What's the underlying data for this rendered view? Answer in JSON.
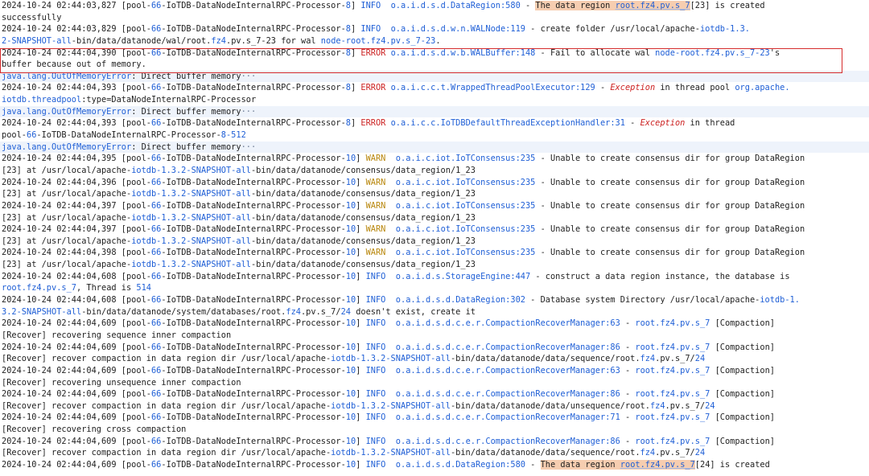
{
  "lines": [
    {
      "k": "L1a",
      "parts": [
        [
          "t",
          "2024-10-24 02:44:03,827 [pool-"
        ],
        [
          "h",
          "66"
        ],
        [
          "t",
          "-IoTDB-DataNodeInternalRPC-Processor-"
        ],
        [
          "h",
          "8"
        ],
        [
          "t",
          "] "
        ],
        [
          "i",
          "INFO"
        ],
        [
          "t",
          "  "
        ],
        [
          "l",
          "o.a.i.d.s.d.DataRegion:580"
        ],
        [
          "t",
          " - "
        ],
        [
          "m",
          "The data region "
        ],
        [
          "ml",
          "root.fz4.pv.s_7"
        ],
        [
          "t",
          "[23] is created"
        ]
      ]
    },
    {
      "k": "L1b",
      "parts": [
        [
          "t",
          "successfully"
        ]
      ]
    },
    {
      "k": "L2a",
      "parts": [
        [
          "t",
          "2024-10-24 02:44:03,829 [pool-"
        ],
        [
          "h",
          "66"
        ],
        [
          "t",
          "-IoTDB-DataNodeInternalRPC-Processor-"
        ],
        [
          "h",
          "8"
        ],
        [
          "t",
          "] "
        ],
        [
          "i",
          "INFO"
        ],
        [
          "t",
          "  "
        ],
        [
          "l",
          "o.a.i.d.s.d.w.n.WALNode:119"
        ],
        [
          "t",
          " - create folder /usr/local/apache-"
        ],
        [
          "h",
          "iotdb-1.3."
        ]
      ]
    },
    {
      "k": "L2b",
      "parts": [
        [
          "h",
          "2-SNAPSHOT-all"
        ],
        [
          "t",
          "-bin/data/datanode/wal/root."
        ],
        [
          "h",
          "fz4"
        ],
        [
          "t",
          ".pv.s_7-23 for wal "
        ],
        [
          "h",
          "node-root.fz4.pv.s_7-23"
        ],
        [
          "t",
          "."
        ]
      ]
    },
    {
      "k": "L3a",
      "parts": [
        [
          "t",
          "2024-10-24 02:44:04,390 [pool-"
        ],
        [
          "h",
          "66"
        ],
        [
          "t",
          "-IoTDB-DataNodeInternalRPC-Processor-"
        ],
        [
          "h",
          "8"
        ],
        [
          "t",
          "] "
        ],
        [
          "e",
          "ERROR"
        ],
        [
          "t",
          " "
        ],
        [
          "l",
          "o.a.i.d.s.d.w.b.WALBuffer:148"
        ],
        [
          "t",
          " - Fail to allocate wal "
        ],
        [
          "h",
          "node-root.fz4.pv.s_7-23"
        ],
        [
          "t",
          "'s"
        ]
      ]
    },
    {
      "k": "L3b",
      "parts": [
        [
          "t",
          "buffer because out of memory."
        ]
      ]
    },
    {
      "k": "X1",
      "exc": true,
      "parts": [
        [
          "x",
          "java.lang.OutOfMemoryError"
        ],
        [
          "t",
          ": Direct buffer memory"
        ],
        [
          "d",
          "···"
        ]
      ]
    },
    {
      "k": "L4a",
      "parts": [
        [
          "t",
          "2024-10-24 02:44:04,393 [pool-"
        ],
        [
          "h",
          "66"
        ],
        [
          "t",
          "-IoTDB-DataNodeInternalRPC-Processor-"
        ],
        [
          "h",
          "8"
        ],
        [
          "t",
          "] "
        ],
        [
          "e",
          "ERROR"
        ],
        [
          "t",
          " "
        ],
        [
          "l",
          "o.a.i.c.c.t.WrappedThreadPoolExecutor:129"
        ],
        [
          "t",
          " - "
        ],
        [
          "y",
          "Exception"
        ],
        [
          "t",
          " in thread pool "
        ],
        [
          "h",
          "org.apache."
        ]
      ]
    },
    {
      "k": "L4b",
      "parts": [
        [
          "h",
          "iotdb.threadpool"
        ],
        [
          "t",
          ":type=DataNodeInternalRPC-Processor"
        ]
      ]
    },
    {
      "k": "X2",
      "exc": true,
      "parts": [
        [
          "x",
          "java.lang.OutOfMemoryError"
        ],
        [
          "t",
          ": Direct buffer memory"
        ],
        [
          "d",
          "···"
        ]
      ]
    },
    {
      "k": "L5a",
      "parts": [
        [
          "t",
          "2024-10-24 02:44:04,393 [pool-"
        ],
        [
          "h",
          "66"
        ],
        [
          "t",
          "-IoTDB-DataNodeInternalRPC-Processor-"
        ],
        [
          "h",
          "8"
        ],
        [
          "t",
          "] "
        ],
        [
          "e",
          "ERROR"
        ],
        [
          "t",
          " "
        ],
        [
          "l",
          "o.a.i.c.c.IoTDBDefaultThreadExceptionHandler:31"
        ],
        [
          "t",
          " - "
        ],
        [
          "y",
          "Exception"
        ],
        [
          "t",
          " in thread"
        ]
      ]
    },
    {
      "k": "L5b",
      "parts": [
        [
          "t",
          "pool-"
        ],
        [
          "h",
          "66"
        ],
        [
          "t",
          "-IoTDB-DataNodeInternalRPC-Processor-"
        ],
        [
          "h",
          "8-512"
        ]
      ]
    },
    {
      "k": "X3",
      "exc": true,
      "parts": [
        [
          "x",
          "java.lang.OutOfMemoryError"
        ],
        [
          "t",
          ": Direct buffer memory"
        ],
        [
          "d",
          "···"
        ]
      ]
    },
    {
      "k": "L6a",
      "parts": [
        [
          "t",
          "2024-10-24 02:44:04,395 [pool-"
        ],
        [
          "h",
          "66"
        ],
        [
          "t",
          "-IoTDB-DataNodeInternalRPC-Processor-"
        ],
        [
          "h",
          "10"
        ],
        [
          "t",
          "] "
        ],
        [
          "w",
          "WARN"
        ],
        [
          "t",
          "  "
        ],
        [
          "l",
          "o.a.i.c.iot.IoTConsensus:235"
        ],
        [
          "t",
          " - Unable to create consensus dir for group DataRegion"
        ]
      ]
    },
    {
      "k": "L6b",
      "parts": [
        [
          "t",
          "[23] at /usr/local/apache-"
        ],
        [
          "h",
          "iotdb-1.3.2-SNAPSHOT-all"
        ],
        [
          "t",
          "-bin/data/datanode/consensus/data_region/1_23"
        ]
      ]
    },
    {
      "k": "L7a",
      "parts": [
        [
          "t",
          "2024-10-24 02:44:04,396 [pool-"
        ],
        [
          "h",
          "66"
        ],
        [
          "t",
          "-IoTDB-DataNodeInternalRPC-Processor-"
        ],
        [
          "h",
          "10"
        ],
        [
          "t",
          "] "
        ],
        [
          "w",
          "WARN"
        ],
        [
          "t",
          "  "
        ],
        [
          "l",
          "o.a.i.c.iot.IoTConsensus:235"
        ],
        [
          "t",
          " - Unable to create consensus dir for group DataRegion"
        ]
      ]
    },
    {
      "k": "L7b",
      "parts": [
        [
          "t",
          "[23] at /usr/local/apache-"
        ],
        [
          "h",
          "iotdb-1.3.2-SNAPSHOT-all"
        ],
        [
          "t",
          "-bin/data/datanode/consensus/data_region/1_23"
        ]
      ]
    },
    {
      "k": "L8a",
      "parts": [
        [
          "t",
          "2024-10-24 02:44:04,397 [pool-"
        ],
        [
          "h",
          "66"
        ],
        [
          "t",
          "-IoTDB-DataNodeInternalRPC-Processor-"
        ],
        [
          "h",
          "10"
        ],
        [
          "t",
          "] "
        ],
        [
          "w",
          "WARN"
        ],
        [
          "t",
          "  "
        ],
        [
          "l",
          "o.a.i.c.iot.IoTConsensus:235"
        ],
        [
          "t",
          " - Unable to create consensus dir for group DataRegion"
        ]
      ]
    },
    {
      "k": "L8b",
      "parts": [
        [
          "t",
          "[23] at /usr/local/apache-"
        ],
        [
          "h",
          "iotdb-1.3.2-SNAPSHOT-all"
        ],
        [
          "t",
          "-bin/data/datanode/consensus/data_region/1_23"
        ]
      ]
    },
    {
      "k": "L9a",
      "parts": [
        [
          "t",
          "2024-10-24 02:44:04,397 [pool-"
        ],
        [
          "h",
          "66"
        ],
        [
          "t",
          "-IoTDB-DataNodeInternalRPC-Processor-"
        ],
        [
          "h",
          "10"
        ],
        [
          "t",
          "] "
        ],
        [
          "w",
          "WARN"
        ],
        [
          "t",
          "  "
        ],
        [
          "l",
          "o.a.i.c.iot.IoTConsensus:235"
        ],
        [
          "t",
          " - Unable to create consensus dir for group DataRegion"
        ]
      ]
    },
    {
      "k": "L9b",
      "parts": [
        [
          "t",
          "[23] at /usr/local/apache-"
        ],
        [
          "h",
          "iotdb-1.3.2-SNAPSHOT-all"
        ],
        [
          "t",
          "-bin/data/datanode/consensus/data_region/1_23"
        ]
      ]
    },
    {
      "k": "L10a",
      "parts": [
        [
          "t",
          "2024-10-24 02:44:04,398 [pool-"
        ],
        [
          "h",
          "66"
        ],
        [
          "t",
          "-IoTDB-DataNodeInternalRPC-Processor-"
        ],
        [
          "h",
          "10"
        ],
        [
          "t",
          "] "
        ],
        [
          "w",
          "WARN"
        ],
        [
          "t",
          "  "
        ],
        [
          "l",
          "o.a.i.c.iot.IoTConsensus:235"
        ],
        [
          "t",
          " - Unable to create consensus dir for group DataRegion"
        ]
      ]
    },
    {
      "k": "L10b",
      "parts": [
        [
          "t",
          "[23] at /usr/local/apache-"
        ],
        [
          "h",
          "iotdb-1.3.2-SNAPSHOT-all"
        ],
        [
          "t",
          "-bin/data/datanode/consensus/data_region/1_23"
        ]
      ]
    },
    {
      "k": "L11a",
      "parts": [
        [
          "t",
          "2024-10-24 02:44:04,608 [pool-"
        ],
        [
          "h",
          "66"
        ],
        [
          "t",
          "-IoTDB-DataNodeInternalRPC-Processor-"
        ],
        [
          "h",
          "10"
        ],
        [
          "t",
          "] "
        ],
        [
          "i",
          "INFO"
        ],
        [
          "t",
          "  "
        ],
        [
          "l",
          "o.a.i.d.s.StorageEngine:447"
        ],
        [
          "t",
          " - construct a data region instance, the database is"
        ]
      ]
    },
    {
      "k": "L11b",
      "parts": [
        [
          "h",
          "root.fz4.pv.s_7"
        ],
        [
          "t",
          ", Thread is "
        ],
        [
          "h",
          "514"
        ]
      ]
    },
    {
      "k": "L12a",
      "parts": [
        [
          "t",
          "2024-10-24 02:44:04,608 [pool-"
        ],
        [
          "h",
          "66"
        ],
        [
          "t",
          "-IoTDB-DataNodeInternalRPC-Processor-"
        ],
        [
          "h",
          "10"
        ],
        [
          "t",
          "] "
        ],
        [
          "i",
          "INFO"
        ],
        [
          "t",
          "  "
        ],
        [
          "l",
          "o.a.i.d.s.d.DataRegion:302"
        ],
        [
          "t",
          " - Database system Directory /usr/local/apache-"
        ],
        [
          "h",
          "iotdb-1."
        ]
      ]
    },
    {
      "k": "L12b",
      "parts": [
        [
          "h",
          "3.2-SNAPSHOT-all"
        ],
        [
          "t",
          "-bin/data/datanode/system/databases/root."
        ],
        [
          "h",
          "fz4"
        ],
        [
          "t",
          ".pv.s_7/"
        ],
        [
          "h",
          "24"
        ],
        [
          "t",
          " doesn't exist, create it"
        ]
      ]
    },
    {
      "k": "L13a",
      "parts": [
        [
          "t",
          "2024-10-24 02:44:04,609 [pool-"
        ],
        [
          "h",
          "66"
        ],
        [
          "t",
          "-IoTDB-DataNodeInternalRPC-Processor-"
        ],
        [
          "h",
          "10"
        ],
        [
          "t",
          "] "
        ],
        [
          "i",
          "INFO"
        ],
        [
          "t",
          "  "
        ],
        [
          "l",
          "o.a.i.d.s.d.c.e.r.CompactionRecoverManager:63"
        ],
        [
          "t",
          " - "
        ],
        [
          "h",
          "root.fz4.pv.s_7"
        ],
        [
          "t",
          " [Compaction]"
        ]
      ]
    },
    {
      "k": "L13b",
      "parts": [
        [
          "t",
          "[Recover] recovering sequence inner compaction"
        ]
      ]
    },
    {
      "k": "L14a",
      "parts": [
        [
          "t",
          "2024-10-24 02:44:04,609 [pool-"
        ],
        [
          "h",
          "66"
        ],
        [
          "t",
          "-IoTDB-DataNodeInternalRPC-Processor-"
        ],
        [
          "h",
          "10"
        ],
        [
          "t",
          "] "
        ],
        [
          "i",
          "INFO"
        ],
        [
          "t",
          "  "
        ],
        [
          "l",
          "o.a.i.d.s.d.c.e.r.CompactionRecoverManager:86"
        ],
        [
          "t",
          " - "
        ],
        [
          "h",
          "root.fz4.pv.s_7"
        ],
        [
          "t",
          " [Compaction]"
        ]
      ]
    },
    {
      "k": "L14b",
      "parts": [
        [
          "t",
          "[Recover] recover compaction in data region dir /usr/local/apache-"
        ],
        [
          "h",
          "iotdb-1.3.2-SNAPSHOT-all"
        ],
        [
          "t",
          "-bin/data/datanode/data/sequence/root."
        ],
        [
          "h",
          "fz4"
        ],
        [
          "t",
          ".pv.s_7/"
        ],
        [
          "h",
          "24"
        ]
      ]
    },
    {
      "k": "L15a",
      "parts": [
        [
          "t",
          "2024-10-24 02:44:04,609 [pool-"
        ],
        [
          "h",
          "66"
        ],
        [
          "t",
          "-IoTDB-DataNodeInternalRPC-Processor-"
        ],
        [
          "h",
          "10"
        ],
        [
          "t",
          "] "
        ],
        [
          "i",
          "INFO"
        ],
        [
          "t",
          "  "
        ],
        [
          "l",
          "o.a.i.d.s.d.c.e.r.CompactionRecoverManager:63"
        ],
        [
          "t",
          " - "
        ],
        [
          "h",
          "root.fz4.pv.s_7"
        ],
        [
          "t",
          " [Compaction]"
        ]
      ]
    },
    {
      "k": "L15b",
      "parts": [
        [
          "t",
          "[Recover] recovering unsequence inner compaction"
        ]
      ]
    },
    {
      "k": "L16a",
      "parts": [
        [
          "t",
          "2024-10-24 02:44:04,609 [pool-"
        ],
        [
          "h",
          "66"
        ],
        [
          "t",
          "-IoTDB-DataNodeInternalRPC-Processor-"
        ],
        [
          "h",
          "10"
        ],
        [
          "t",
          "] "
        ],
        [
          "i",
          "INFO"
        ],
        [
          "t",
          "  "
        ],
        [
          "l",
          "o.a.i.d.s.d.c.e.r.CompactionRecoverManager:86"
        ],
        [
          "t",
          " - "
        ],
        [
          "h",
          "root.fz4.pv.s_7"
        ],
        [
          "t",
          " [Compaction]"
        ]
      ]
    },
    {
      "k": "L16b",
      "parts": [
        [
          "t",
          "[Recover] recover compaction in data region dir /usr/local/apache-"
        ],
        [
          "h",
          "iotdb-1.3.2-SNAPSHOT-all"
        ],
        [
          "t",
          "-bin/data/datanode/data/unsequence/root."
        ],
        [
          "h",
          "fz4"
        ],
        [
          "t",
          ".pv.s_7/"
        ],
        [
          "h",
          "24"
        ]
      ]
    },
    {
      "k": "L17a",
      "parts": [
        [
          "t",
          "2024-10-24 02:44:04,609 [pool-"
        ],
        [
          "h",
          "66"
        ],
        [
          "t",
          "-IoTDB-DataNodeInternalRPC-Processor-"
        ],
        [
          "h",
          "10"
        ],
        [
          "t",
          "] "
        ],
        [
          "i",
          "INFO"
        ],
        [
          "t",
          "  "
        ],
        [
          "l",
          "o.a.i.d.s.d.c.e.r.CompactionRecoverManager:71"
        ],
        [
          "t",
          " - "
        ],
        [
          "h",
          "root.fz4.pv.s_7"
        ],
        [
          "t",
          " [Compaction]"
        ]
      ]
    },
    {
      "k": "L17b",
      "parts": [
        [
          "t",
          "[Recover] recovering cross compaction"
        ]
      ]
    },
    {
      "k": "L18a",
      "parts": [
        [
          "t",
          "2024-10-24 02:44:04,609 [pool-"
        ],
        [
          "h",
          "66"
        ],
        [
          "t",
          "-IoTDB-DataNodeInternalRPC-Processor-"
        ],
        [
          "h",
          "10"
        ],
        [
          "t",
          "] "
        ],
        [
          "i",
          "INFO"
        ],
        [
          "t",
          "  "
        ],
        [
          "l",
          "o.a.i.d.s.d.c.e.r.CompactionRecoverManager:86"
        ],
        [
          "t",
          " - "
        ],
        [
          "h",
          "root.fz4.pv.s_7"
        ],
        [
          "t",
          " [Compaction]"
        ]
      ]
    },
    {
      "k": "L18b",
      "parts": [
        [
          "t",
          "[Recover] recover compaction in data region dir /usr/local/apache-"
        ],
        [
          "h",
          "iotdb-1.3.2-SNAPSHOT-all"
        ],
        [
          "t",
          "-bin/data/datanode/data/sequence/root."
        ],
        [
          "h",
          "fz4"
        ],
        [
          "t",
          ".pv.s_7/"
        ],
        [
          "h",
          "24"
        ]
      ]
    },
    {
      "k": "L19a",
      "parts": [
        [
          "t",
          "2024-10-24 02:44:04,609 [pool-"
        ],
        [
          "h",
          "66"
        ],
        [
          "t",
          "-IoTDB-DataNodeInternalRPC-Processor-"
        ],
        [
          "h",
          "10"
        ],
        [
          "t",
          "] "
        ],
        [
          "i",
          "INFO"
        ],
        [
          "t",
          "  "
        ],
        [
          "l",
          "o.a.i.d.s.d.DataRegion:580"
        ],
        [
          "t",
          " - "
        ],
        [
          "m",
          "The data region "
        ],
        [
          "ml",
          "root.fz4.pv.s_7"
        ],
        [
          "t",
          "[24] is created"
        ]
      ]
    }
  ],
  "colors": {
    "info": "#1f5fd6",
    "warn": "#b8860b",
    "error": "#cc2222",
    "highlight": "#f6cdb0",
    "error_box": "#d62c2c"
  }
}
